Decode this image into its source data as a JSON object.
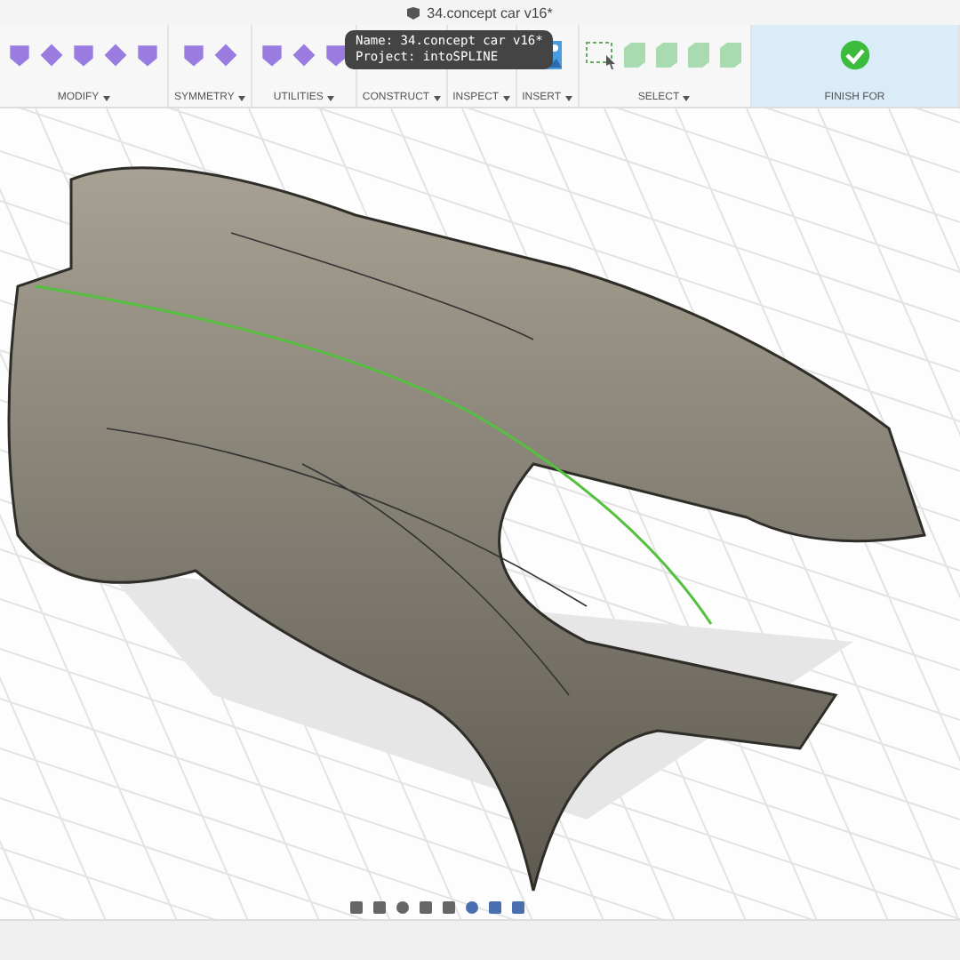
{
  "window": {
    "title": "34.concept car v16*"
  },
  "tooltip": {
    "lines": [
      "Name: 34.concept car v16*",
      "Project: intoSPLINE"
    ]
  },
  "toolbar": {
    "groups": [
      {
        "label": "MODIFY",
        "has_menu": true
      },
      {
        "label": "SYMMETRY",
        "has_menu": true
      },
      {
        "label": "UTILITIES",
        "has_menu": true
      },
      {
        "label": "CONSTRUCT",
        "has_menu": true
      },
      {
        "label": "INSPECT",
        "has_menu": true
      },
      {
        "label": "INSERT",
        "has_menu": true
      },
      {
        "label": "SELECT",
        "has_menu": true
      },
      {
        "label": "FINISH FOR",
        "has_menu": false,
        "selected": true
      }
    ]
  }
}
